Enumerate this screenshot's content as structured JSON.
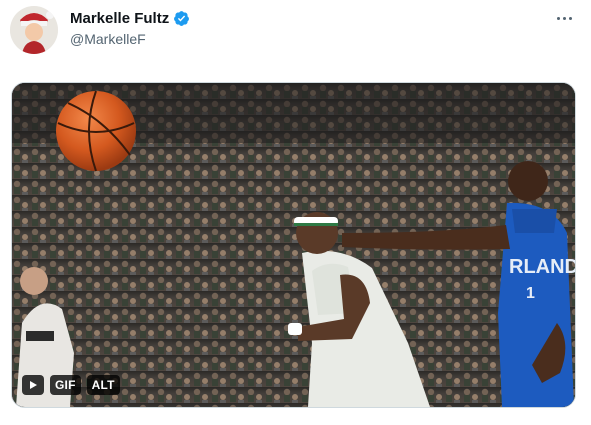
{
  "user": {
    "display_name": "Markelle Fultz",
    "handle": "@MarkelleF",
    "verified": true
  },
  "media": {
    "gif_label": "GIF",
    "alt_label": "ALT"
  },
  "icons": {
    "verified": "verified-badge-icon",
    "more": "more-icon",
    "play": "play-icon"
  },
  "colors": {
    "verified_blue": "#1d9bf0",
    "handle_gray": "#536471"
  }
}
